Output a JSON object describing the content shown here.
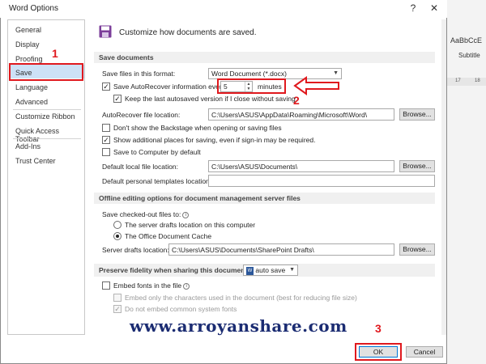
{
  "window": {
    "title": "Word Options",
    "help": "?",
    "close": "✕"
  },
  "background": {
    "style_sample": "AaBbCcE",
    "style_name": "Subtitle",
    "ruler": [
      "17",
      "18"
    ]
  },
  "nav": {
    "items": [
      "General",
      "Display",
      "Proofing",
      "Save",
      "Language",
      "Advanced",
      "Customize Ribbon",
      "Quick Access Toolbar",
      "Add-Ins",
      "Trust Center"
    ],
    "selected": "Save"
  },
  "annotations": {
    "step1": "1",
    "step2": "2",
    "step3": "3",
    "watermark": "www.arroyanshare.com"
  },
  "header": {
    "text": "Customize how documents are saved."
  },
  "save_documents": {
    "section": "Save documents",
    "format_label": "Save files in this format:",
    "format_value": "Word Document (*.docx)",
    "autorecover_label": "Save AutoRecover information every",
    "autorecover_minutes": "5",
    "minutes_label": "minutes",
    "keep_last_label": "Keep the last autosaved version if I close without saving",
    "autorecover_location_label": "AutoRecover file location:",
    "autorecover_location_value": "C:\\Users\\ASUS\\AppData\\Roaming\\Microsoft\\Word\\",
    "browse_label": "Browse...",
    "no_backstage_label": "Don't show the Backstage when opening or saving files",
    "show_places_label": "Show additional places for saving, even if sign-in may be required.",
    "save_computer_label": "Save to Computer by default",
    "local_location_label": "Default local file location:",
    "local_location_value": "C:\\Users\\ASUS\\Documents\\",
    "templates_location_label": "Default personal templates location:",
    "templates_location_value": ""
  },
  "offline": {
    "section": "Offline editing options for document management server files",
    "checked_out_label": "Save checked-out files to:",
    "server_drafts_option": "The server drafts location on this computer",
    "cache_option": "The Office Document Cache",
    "server_location_label": "Server drafts location:",
    "server_location_value": "C:\\Users\\ASUS\\Documents\\SharePoint Drafts\\"
  },
  "fidelity": {
    "section": "Preserve fidelity when sharing this document:",
    "doc_value": "auto save",
    "embed_fonts_label": "Embed fonts in the file",
    "embed_only_label": "Embed only the characters used in the document (best for reducing file size)",
    "no_common_label": "Do not embed common system fonts"
  },
  "footer": {
    "ok": "OK",
    "cancel": "Cancel"
  },
  "colors": {
    "accent_red": "#e0191e",
    "nav_selected": "#cde1f6",
    "watermark": "#1b2c72"
  }
}
